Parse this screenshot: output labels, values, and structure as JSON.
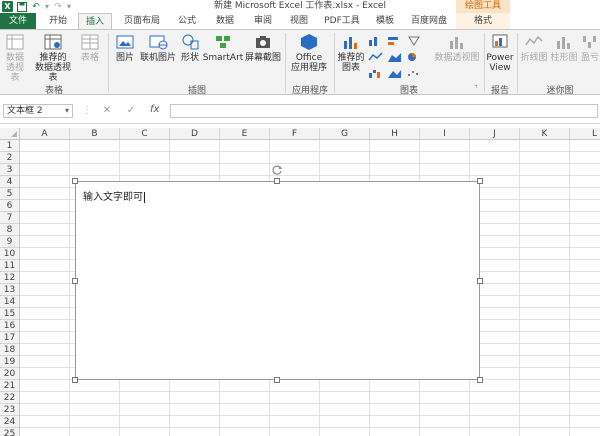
{
  "titlebar": {
    "title": "新建 Microsoft Excel 工作表.xlsx - Excel",
    "context_group": "绘图工具",
    "logo": "X"
  },
  "tabs": [
    {
      "label": "文件"
    },
    {
      "label": "开始"
    },
    {
      "label": "插入"
    },
    {
      "label": "页面布局"
    },
    {
      "label": "公式"
    },
    {
      "label": "数据"
    },
    {
      "label": "审阅"
    },
    {
      "label": "视图"
    },
    {
      "label": "PDF工具"
    },
    {
      "label": "模板"
    },
    {
      "label": "百度网盘"
    },
    {
      "label": "格式"
    }
  ],
  "ribbon": {
    "tables": {
      "pivot": "数据\n透视表",
      "recommended_pivot": "推荐的\n数据透视表",
      "table": "表格",
      "group": "表格"
    },
    "illustrations": {
      "pictures": "图片",
      "online_pictures": "联机图片",
      "shapes": "形状",
      "smartart": "SmartArt",
      "screenshot": "屏幕截图",
      "group": "插图"
    },
    "apps": {
      "office_apps": "Office\n应用程序",
      "group": "应用程序"
    },
    "charts": {
      "recommended": "推荐的\n图表",
      "pivot_chart": "数据透视图",
      "group": "图表"
    },
    "reports": {
      "power_view": "Power\nView",
      "group": "报告"
    },
    "sparklines": {
      "line": "折线图",
      "column": "柱形图",
      "winloss": "盈亏",
      "group": "迷你图"
    }
  },
  "formula_bar": {
    "name_box": "文本框 2",
    "fx": "fx",
    "value": ""
  },
  "grid": {
    "columns": [
      "A",
      "B",
      "C",
      "D",
      "E",
      "F",
      "G",
      "H",
      "I",
      "J",
      "K",
      "L"
    ],
    "rows": [
      "1",
      "2",
      "3",
      "4",
      "5",
      "6",
      "7",
      "8",
      "9",
      "10",
      "11",
      "12",
      "13",
      "14",
      "15",
      "16",
      "17",
      "18",
      "19",
      "20",
      "21",
      "22",
      "23",
      "24",
      "25"
    ]
  },
  "textbox": {
    "text": "输入文字即可"
  },
  "colors": {
    "excel_green": "#217346",
    "context_orange": "#d26a00",
    "ribbon_bg": "#f3f3f3"
  }
}
